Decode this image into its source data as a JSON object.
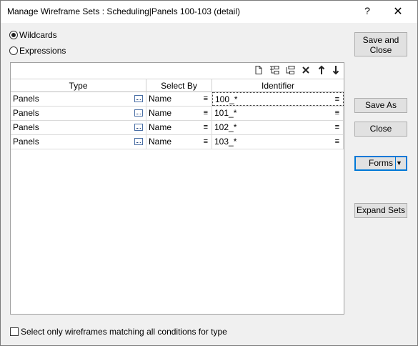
{
  "window": {
    "title": "Manage Wireframe Sets : Scheduling|Panels 100-103 (detail)",
    "help_label": "?",
    "close_label": "✕"
  },
  "mode": {
    "wildcards_label": "Wildcards",
    "expressions_label": "Expressions",
    "selected": "Wildcards"
  },
  "table": {
    "columns": [
      "Type",
      "Select By",
      "Identifier"
    ],
    "rows": [
      {
        "type": "Panels",
        "select_by": "Name",
        "identifier": "100_*"
      },
      {
        "type": "Panels",
        "select_by": "Name",
        "identifier": "101_*"
      },
      {
        "type": "Panels",
        "select_by": "Name",
        "identifier": "102_*"
      },
      {
        "type": "Panels",
        "select_by": "Name",
        "identifier": "103_*"
      }
    ],
    "toolbar_icons": [
      "new-row-icon",
      "insert-row-icon",
      "insert-child-icon",
      "delete-row-icon",
      "move-up-icon",
      "move-down-icon"
    ]
  },
  "buttons": {
    "save_close": "Save and Close",
    "save_as": "Save As",
    "close": "Close",
    "forms": "Forms",
    "expand_sets": "Expand Sets"
  },
  "options": {
    "match_all_label": "Select only wireframes matching all conditions for type",
    "match_all_checked": false
  },
  "colors": {
    "accent": "#0078d7",
    "dialog_bg": "#f0f0f0"
  }
}
